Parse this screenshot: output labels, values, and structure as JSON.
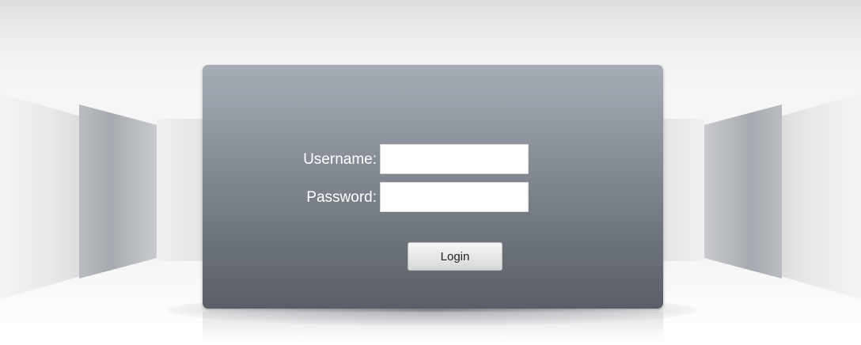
{
  "login_form": {
    "username_label": "Username:",
    "username_value": "",
    "password_label": "Password:",
    "password_value": "",
    "login_button_label": "Login"
  },
  "colors": {
    "panel_top": "#a7adb6",
    "panel_bottom": "#5a5f67",
    "label_text": "#ffffff",
    "button_top": "#f6f6f6",
    "button_bottom": "#d6d7d9"
  }
}
